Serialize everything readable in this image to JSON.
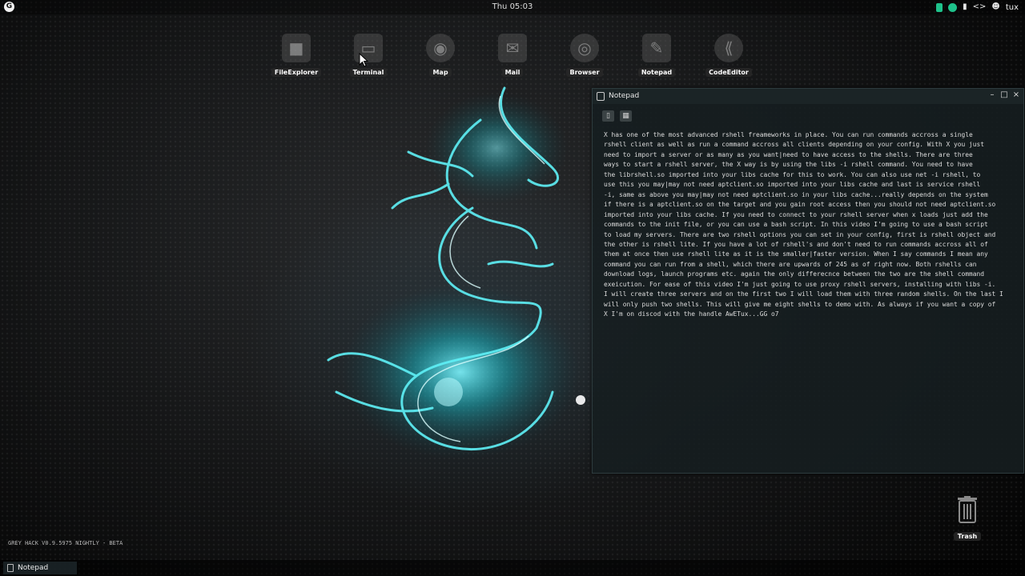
{
  "topbar": {
    "logo_letter": "G",
    "clock": "Thu 05:03",
    "user": "tux",
    "tray_icons": [
      "green-indicator-icon",
      "network-icon",
      "clipboard-icon",
      "code-icon",
      "user-icon"
    ]
  },
  "desktop_icons": [
    {
      "label": "FileExplorer",
      "icon": "folder-icon"
    },
    {
      "label": "Terminal",
      "icon": "terminal-icon"
    },
    {
      "label": "Map",
      "icon": "globe-icon"
    },
    {
      "label": "Mail",
      "icon": "mail-icon"
    },
    {
      "label": "Browser",
      "icon": "browser-icon"
    },
    {
      "label": "Notepad",
      "icon": "notepad-icon"
    },
    {
      "label": "CodeEditor",
      "icon": "code-editor-icon"
    }
  ],
  "notepad": {
    "title": "Notepad",
    "toolbar": [
      "open-folder-icon",
      "save-icon"
    ],
    "lines": [
      "X has one of the most advanced rshell freameworks in place. You can run commands accross a single",
      "rshell client as well as run a command accross all clients depending on your config. With X you just",
      "need to import a server or as many as you want|need to have access to the shells. There are three",
      "ways to start a rshell server, the X way is by using the libs -i rshell command. You need to have",
      "the librshell.so imported into your libs cache for this to work. You can also use net -i rshell, to",
      "use this you may|may not need aptclient.so imported into your libs cache and last is service rshell",
      "-i, same as above you may|may not need aptclient.so in your libs cache...really depends on the system",
      "if there is a aptclient.so on the target and you gain root access then you should not need aptclient.so",
      "imported into your libs cache. If you need to connect to your rshell server when x loads just add the",
      "commands to the init file, or you can use a bash script. In this video I'm going to use a bash script",
      "to load my servers. There are two rshell options you can set in your config, first is rshell object and",
      "the other is rshell lite. If you have a lot of rshell's and don't need to run commands accross all of",
      "them at once then use rshell lite as it is the smaller|faster version. When I say commands I mean any",
      "command you can run from a shell, which there are upwards of 245 as of right now. Both rshells can",
      "download logs, launch programs etc. again the only differecnce between the two are the shell command",
      "exeicution. For ease of this video I'm just going to use proxy rshell servers, installing with libs -i.",
      "I will create three servers and on the first two I will load them with three random shells. On the last I",
      "will only push two shells. This will give me eight shells to demo with. As always if you want a copy of",
      "X I'm on discod with the handle AwETux...GG o7"
    ]
  },
  "trash": {
    "label": "Trash"
  },
  "version_text": "GREY HACK V0.9.5975 NIGHTLY - BETA",
  "taskbar": {
    "items": [
      {
        "label": "Notepad"
      }
    ]
  },
  "colors": {
    "accent": "#2fe0e8",
    "status_green": "#1ec28b"
  }
}
